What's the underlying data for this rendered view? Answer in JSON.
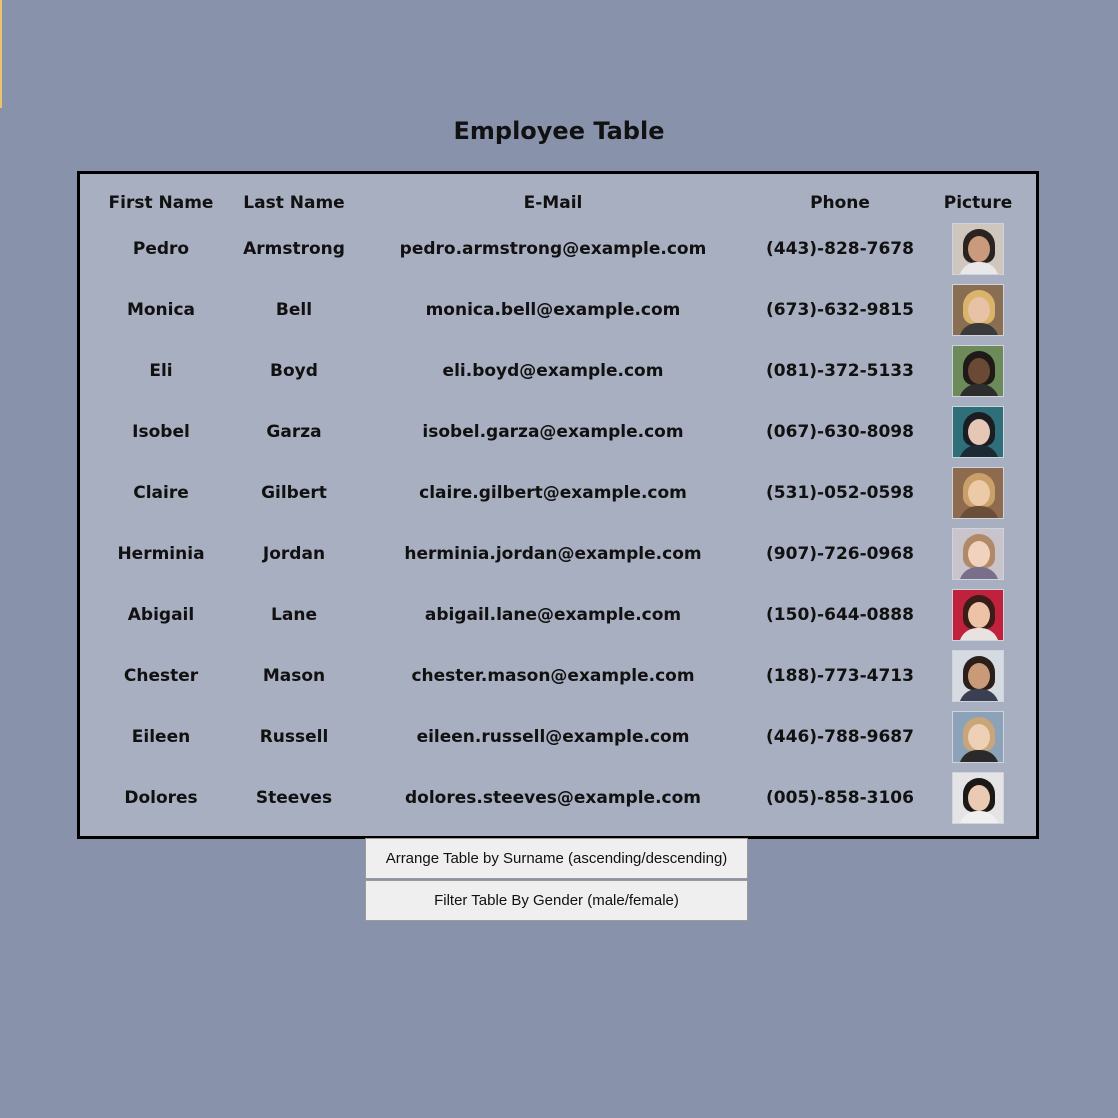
{
  "page": {
    "title": "Employee Table"
  },
  "table": {
    "headers": [
      "First Name",
      "Last Name",
      "E-Mail",
      "Phone",
      "Picture"
    ],
    "rows": [
      {
        "first": "Pedro",
        "last": "Armstrong",
        "email": "pedro.armstrong@example.com",
        "phone": "(443)-828-7678",
        "photo": {
          "bg": "#cfc7bd",
          "hair": "#2b2320",
          "skin": "#c99a7b",
          "shirt": "#e8e8e8"
        }
      },
      {
        "first": "Monica",
        "last": "Bell",
        "email": "monica.bell@example.com",
        "phone": "(673)-632-9815",
        "photo": {
          "bg": "#8a6e54",
          "hair": "#d9b46a",
          "skin": "#e7c2a4",
          "shirt": "#3a3a3a"
        }
      },
      {
        "first": "Eli",
        "last": "Boyd",
        "email": "eli.boyd@example.com",
        "phone": "(081)-372-5133",
        "photo": {
          "bg": "#6d8a5b",
          "hair": "#1f1a17",
          "skin": "#6b4a35",
          "shirt": "#2d2d2d"
        }
      },
      {
        "first": "Isobel",
        "last": "Garza",
        "email": "isobel.garza@example.com",
        "phone": "(067)-630-8098",
        "photo": {
          "bg": "#2f6f7a",
          "hair": "#1a1e22",
          "skin": "#e6c6b5",
          "shirt": "#1c2a33"
        }
      },
      {
        "first": "Claire",
        "last": "Gilbert",
        "email": "claire.gilbert@example.com",
        "phone": "(531)-052-0598",
        "photo": {
          "bg": "#8e6a4e",
          "hair": "#c9a06a",
          "skin": "#eccaa8",
          "shirt": "#6a4e3a"
        }
      },
      {
        "first": "Herminia",
        "last": "Jordan",
        "email": "herminia.jordan@example.com",
        "phone": "(907)-726-0968",
        "photo": {
          "bg": "#c9c4cc",
          "hair": "#b08a66",
          "skin": "#f0d2bd",
          "shirt": "#7a6f8a"
        }
      },
      {
        "first": "Abigail",
        "last": "Lane",
        "email": "abigail.lane@example.com",
        "phone": "(150)-644-0888",
        "photo": {
          "bg": "#c0213d",
          "hair": "#3a1d17",
          "skin": "#edc3a8",
          "shirt": "#e8e2e0"
        }
      },
      {
        "first": "Chester",
        "last": "Mason",
        "email": "chester.mason@example.com",
        "phone": "(188)-773-4713",
        "photo": {
          "bg": "#d6dbe2",
          "hair": "#2a1f1a",
          "skin": "#c89a78",
          "shirt": "#3b3f52"
        }
      },
      {
        "first": "Eileen",
        "last": "Russell",
        "email": "eileen.russell@example.com",
        "phone": "(446)-788-9687",
        "photo": {
          "bg": "#8ca2b8",
          "hair": "#c9a57a",
          "skin": "#edd0b6",
          "shirt": "#2a2a2a"
        }
      },
      {
        "first": "Dolores",
        "last": "Steeves",
        "email": "dolores.steeves@example.com",
        "phone": "(005)-858-3106",
        "photo": {
          "bg": "#e4e4e6",
          "hair": "#1c1816",
          "skin": "#ebcab3",
          "shirt": "#efefef"
        }
      }
    ]
  },
  "buttons": {
    "sort_label": "Arrange Table by Surname (ascending/descending)",
    "filter_label": "Filter Table By Gender (male/female)"
  }
}
